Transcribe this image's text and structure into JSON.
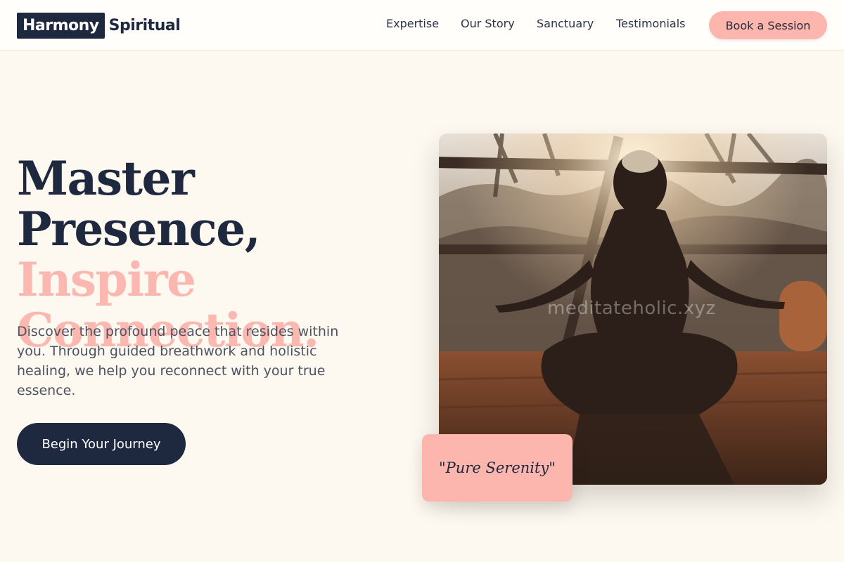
{
  "header": {
    "logo_box": "Harmony",
    "logo_text": "Spiritual",
    "nav": [
      "Expertise",
      "Our Story",
      "Sanctuary",
      "Testimonials"
    ],
    "cta": "Book a Session"
  },
  "hero": {
    "headline_line1": "Master Presence,",
    "headline_line2": "Inspire",
    "headline_line3": "Connection.",
    "lead": "Discover the profound peace that resides within you. Through guided breathwork and holistic healing, we help you reconnect with your true essence.",
    "cta": "Begin Your Journey"
  },
  "image": {
    "watermark": "meditateholic.xyz",
    "quote": "\"Pure Serenity\""
  },
  "colors": {
    "navy": "#1e2940",
    "blush": "#fbb8b0",
    "cream": "#fdf9f0"
  }
}
